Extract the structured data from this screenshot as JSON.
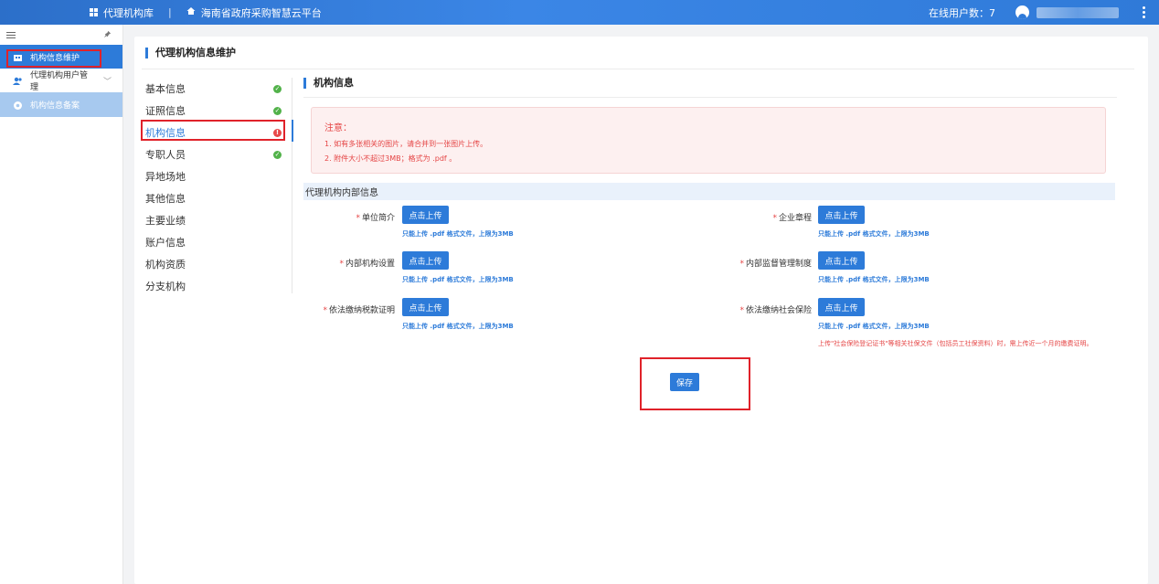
{
  "topbar": {
    "app_name": "代理机构库",
    "separator": "|",
    "platform_name": "海南省政府采购智慧云平台",
    "online_label": "在线用户数：7"
  },
  "sidebar": {
    "items": [
      {
        "label": "机构信息维护",
        "icon": "building-icon"
      },
      {
        "label": "代理机构用户管理",
        "icon": "users-icon"
      },
      {
        "label": "机构信息备案",
        "icon": "gear-icon"
      }
    ]
  },
  "panel": {
    "title": "代理机构信息维护"
  },
  "subnav": {
    "items": [
      {
        "label": "基本信息",
        "status": "ok"
      },
      {
        "label": "证照信息",
        "status": "ok"
      },
      {
        "label": "机构信息",
        "status": "error"
      },
      {
        "label": "专职人员",
        "status": "ok"
      },
      {
        "label": "异地场地",
        "status": ""
      },
      {
        "label": "其他信息",
        "status": ""
      },
      {
        "label": "主要业绩",
        "status": ""
      },
      {
        "label": "账户信息",
        "status": ""
      },
      {
        "label": "机构资质",
        "status": ""
      },
      {
        "label": "分支机构",
        "status": ""
      }
    ]
  },
  "content": {
    "section_title": "机构信息",
    "notice": {
      "title": "注意：",
      "line1": "1. 如有多张相关的图片，请合并到一张图片上传。",
      "line2": "2. 附件大小不超过3MB；格式为 .pdf 。"
    },
    "group_title": "代理机构内部信息",
    "upload_label": "点击上传",
    "upload_tip": "只能上传 .pdf 格式文件，上限为3MB",
    "fields": [
      {
        "label": "单位简介"
      },
      {
        "label": "企业章程"
      },
      {
        "label": "内部机构设置"
      },
      {
        "label": "内部监督管理制度"
      },
      {
        "label": "依法缴纳税款证明"
      },
      {
        "label": "依法缴纳社会保险"
      }
    ],
    "social_insurance_warning": "上传\"社会保险登记证书\"等相关社保文件（包括员工社保资料）时，需上传近一个月的缴费证明。",
    "save_label": "保存"
  }
}
